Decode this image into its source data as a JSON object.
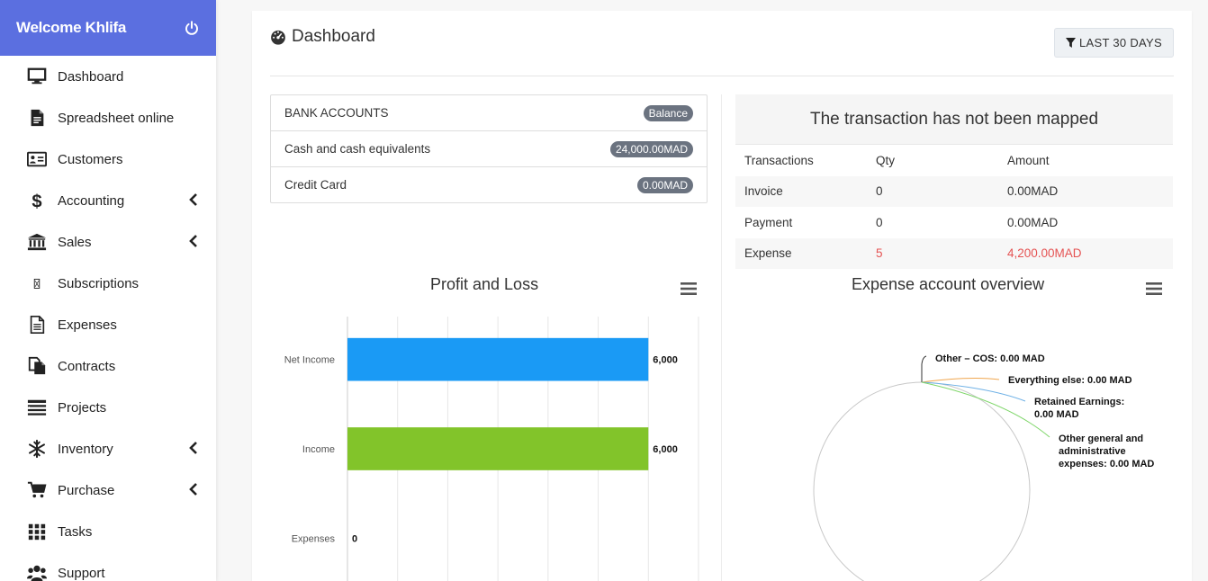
{
  "sidebar": {
    "welcome": "Welcome Khlifa",
    "items": [
      {
        "label": "Dashboard",
        "icon": "monitor-icon",
        "has_submenu": false
      },
      {
        "label": "Spreadsheet online",
        "icon": "file-text-icon",
        "has_submenu": false
      },
      {
        "label": "Customers",
        "icon": "id-card-icon",
        "has_submenu": false
      },
      {
        "label": "Accounting",
        "icon": "dollar-icon",
        "has_submenu": true
      },
      {
        "label": "Sales",
        "icon": "bank-icon",
        "has_submenu": true
      },
      {
        "label": "Subscriptions",
        "icon": "broken-glyph-icon",
        "has_submenu": false
      },
      {
        "label": "Expenses",
        "icon": "file-lines-icon",
        "has_submenu": false
      },
      {
        "label": "Contracts",
        "icon": "copy-files-icon",
        "has_submenu": false
      },
      {
        "label": "Projects",
        "icon": "list-bars-icon",
        "has_submenu": false
      },
      {
        "label": "Inventory",
        "icon": "snowflake-icon",
        "has_submenu": true
      },
      {
        "label": "Purchase",
        "icon": "cart-icon",
        "has_submenu": true
      },
      {
        "label": "Tasks",
        "icon": "grid-icon",
        "has_submenu": false
      },
      {
        "label": "Support",
        "icon": "users-icon",
        "has_submenu": false
      }
    ]
  },
  "header": {
    "title": "Dashboard",
    "filter_label": "LAST 30 DAYS"
  },
  "bank_accounts": {
    "title": "BANK ACCOUNTS",
    "header_badge": "Balance",
    "rows": [
      {
        "name": "Cash and cash equivalents",
        "balance": "24,000.00MAD"
      },
      {
        "name": "Credit Card",
        "balance": "0.00MAD"
      }
    ]
  },
  "transactions": {
    "title": "The transaction has not been mapped",
    "columns": [
      "Transactions",
      "Qty",
      "Amount"
    ],
    "rows": [
      {
        "name": "Invoice",
        "qty": "0",
        "amount": "0.00MAD",
        "highlight": false
      },
      {
        "name": "Payment",
        "qty": "0",
        "amount": "0.00MAD",
        "highlight": false
      },
      {
        "name": "Expense",
        "qty": "5",
        "amount": "4,200.00MAD",
        "highlight": true
      }
    ]
  },
  "colors": {
    "brand": "#5b6fe0",
    "net_income": "#1a9af5",
    "income": "#82c42a",
    "alert": "#e55353"
  },
  "chart_data": [
    {
      "type": "bar",
      "orientation": "horizontal",
      "title": "Profit and Loss",
      "categories": [
        "Net Income",
        "Income",
        "Expenses"
      ],
      "values": [
        6000,
        6000,
        0
      ],
      "value_labels": [
        "6,000",
        "6,000",
        "0"
      ],
      "colors": [
        "#1a9af5",
        "#82c42a",
        "#999999"
      ],
      "xlim": [
        0,
        7000
      ],
      "grid": true
    },
    {
      "type": "pie",
      "title": "Expense account overview",
      "slices": [
        {
          "label": "Other - COS: 0.00 MAD",
          "value": 0,
          "color": "#333333"
        },
        {
          "label": "Everything else: 0.00 MAD",
          "value": 0,
          "color": "#f0a64e"
        },
        {
          "label": "Retained Earnings: 0.00 MAD",
          "value": 0,
          "color": "#6fb1e6"
        },
        {
          "label": "Other general and administrative expenses: 0.00 MAD",
          "value": 0,
          "color": "#7fd66a"
        }
      ]
    }
  ]
}
